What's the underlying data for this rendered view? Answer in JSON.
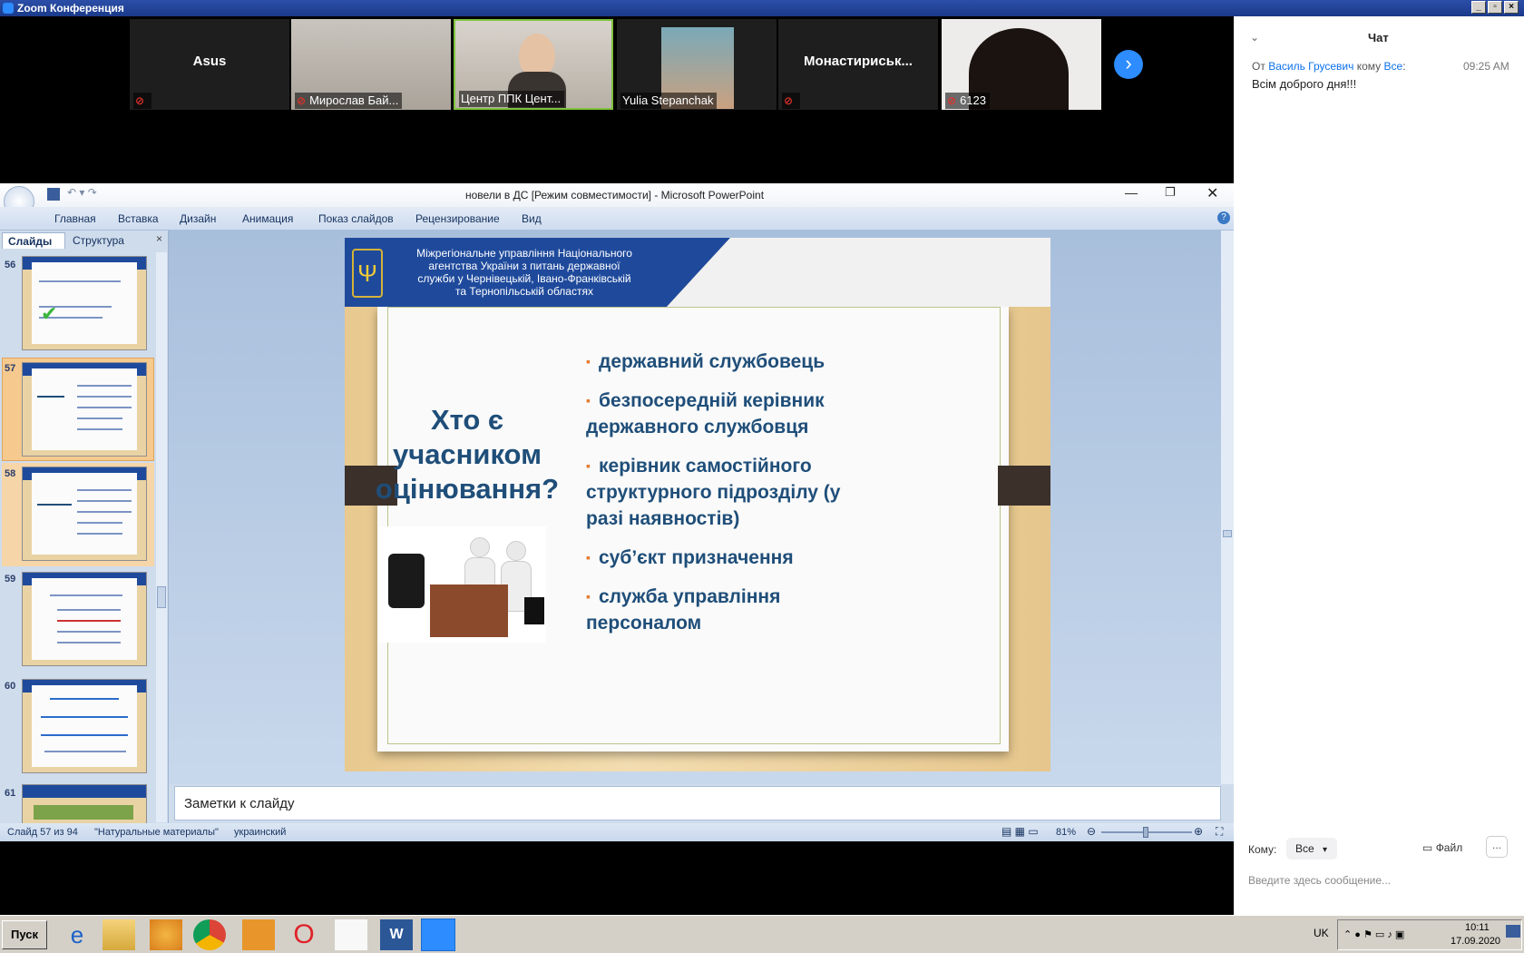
{
  "zoom": {
    "window_title": "Zoom Конференция",
    "participants": [
      {
        "name": "Asus",
        "label": ""
      },
      {
        "name": "",
        "label": "Мирослав Бай..."
      },
      {
        "name": "",
        "label": "Центр ППК Цент..."
      },
      {
        "name": "",
        "label": "Yulia Stepanchak"
      },
      {
        "name": "Монастириськ...",
        "label": ""
      },
      {
        "name": "",
        "label": "6123"
      }
    ]
  },
  "chat": {
    "title": "Чат",
    "message": {
      "prefix": "От",
      "sender": "Василь Грусевич",
      "to_word": "кому",
      "recipient": "Все",
      "time": "09:25 AM",
      "text": "Всім доброго дня!!!"
    },
    "to_label": "Кому:",
    "to_value": "Все",
    "file_label": "Файл",
    "more": "...",
    "input_placeholder": "Введите здесь сообщение..."
  },
  "powerpoint": {
    "title": "новели в ДС [Режим совместимости] - Microsoft PowerPoint",
    "tabs": [
      "Главная",
      "Вставка",
      "Дизайн",
      "Анимация",
      "Показ слайдов",
      "Рецензирование",
      "Вид"
    ],
    "panel_tabs": [
      "Слайды",
      "Структура"
    ],
    "thumbnails": [
      "56",
      "57",
      "58",
      "59",
      "60",
      "61"
    ],
    "slide": {
      "header": [
        "Міжрегіональне управління Національного",
        "агентства України з питань державної",
        "служби  у Чернівецькій, Івано-Франківській",
        "та Тернопільській областях"
      ],
      "question": [
        "Хто є",
        "учасником",
        "оцінювання?"
      ],
      "bullets": [
        {
          "lines": [
            "державний службовець"
          ]
        },
        {
          "lines": [
            "безпосередній керівник",
            "державного службовця"
          ]
        },
        {
          "lines": [
            "керівник самостійного",
            "структурного підрозділу (у",
            "разі наявностів)"
          ]
        },
        {
          "lines": [
            "суб’єкт призначення"
          ]
        },
        {
          "lines": [
            "служба управління",
            "персоналом"
          ]
        }
      ]
    },
    "notes_placeholder": "Заметки к слайду",
    "status": {
      "slide": "Слайд 57 из 94",
      "theme": "\"Натуральные материалы\"",
      "lang": "украинский",
      "zoom": "81%"
    }
  },
  "taskbar": {
    "start": "Пуск",
    "lang": "UK",
    "time": "10:11",
    "date": "17.09.2020"
  },
  "colors": {
    "accent_blue": "#2d8cff",
    "slide_blue": "#1f4a9c",
    "bullet_text": "#1f4e79",
    "bullet_mark": "#e57b2f"
  }
}
